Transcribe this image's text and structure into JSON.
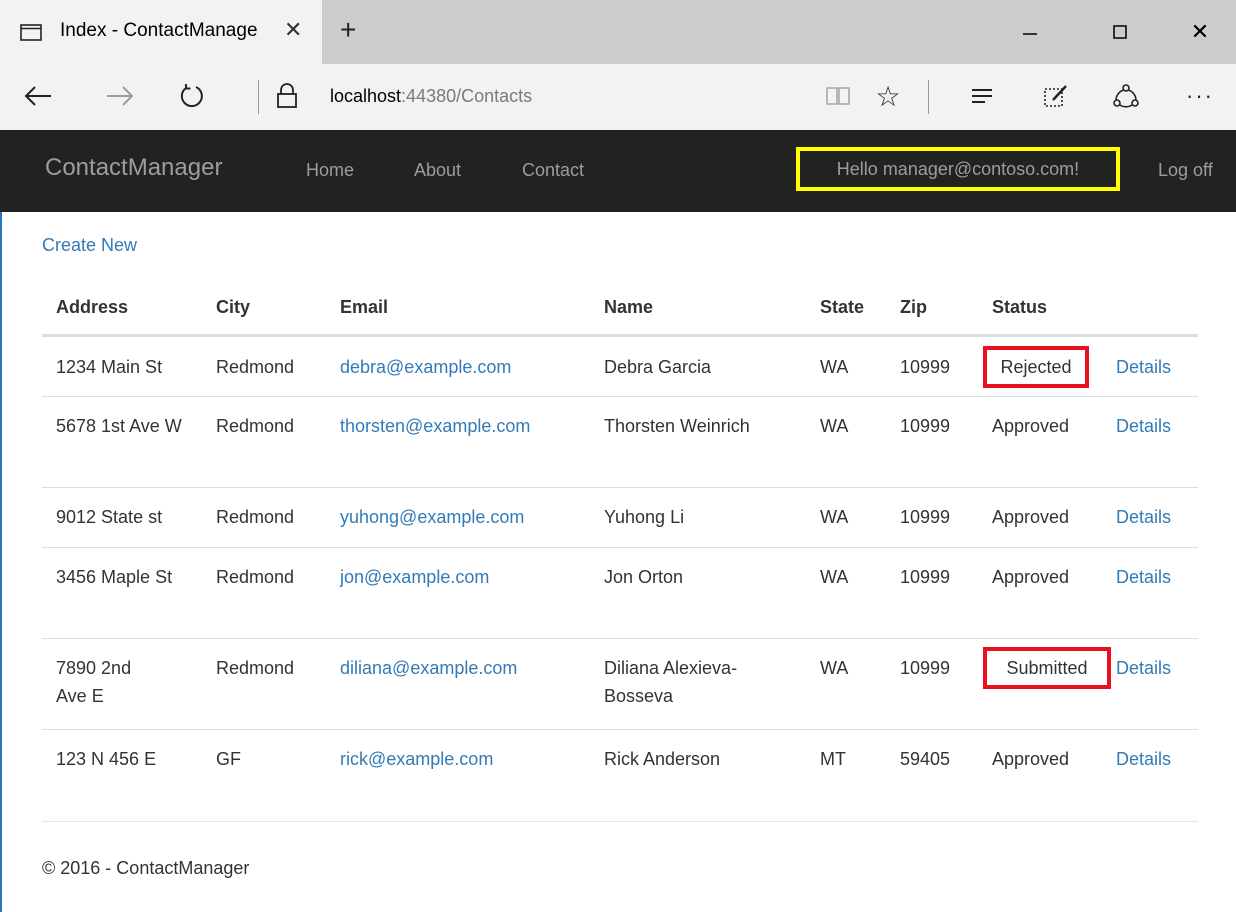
{
  "browser": {
    "tab_title": "Index - ContactManage",
    "url_host": "localhost",
    "url_rest": ":44380/Contacts"
  },
  "navbar": {
    "brand": "ContactManager",
    "links": [
      "Home",
      "About",
      "Contact"
    ],
    "hello": "Hello manager@contoso.com!",
    "logoff": "Log off",
    "highlight_color": "#ffff00"
  },
  "main": {
    "create_new": "Create New",
    "columns": [
      "Address",
      "City",
      "Email",
      "Name",
      "State",
      "Zip",
      "Status"
    ],
    "rows": [
      {
        "address": "1234 Main St",
        "city": "Redmond",
        "email": "debra@example.com",
        "name": "Debra Garcia",
        "state": "WA",
        "zip": "10999",
        "status": "Rejected",
        "details": "Details"
      },
      {
        "address": "5678 1st Ave W",
        "city": "Redmond",
        "email": "thorsten@example.com",
        "name": "Thorsten Weinrich",
        "state": "WA",
        "zip": "10999",
        "status": "Approved",
        "details": "Details"
      },
      {
        "address": "9012 State st",
        "city": "Redmond",
        "email": "yuhong@example.com",
        "name": "Yuhong Li",
        "state": "WA",
        "zip": "10999",
        "status": "Approved",
        "details": "Details"
      },
      {
        "address": "3456 Maple St",
        "city": "Redmond",
        "email": "jon@example.com",
        "name": "Jon Orton",
        "state": "WA",
        "zip": "10999",
        "status": "Approved",
        "details": "Details"
      },
      {
        "address": "7890 2nd Ave E",
        "city": "Redmond",
        "email": "diliana@example.com",
        "name": "Diliana Alexieva-Bosseva",
        "state": "WA",
        "zip": "10999",
        "status": "Submitted",
        "details": "Details"
      },
      {
        "address": "123 N 456 E",
        "city": "GF",
        "email": "rick@example.com",
        "name": "Rick Anderson",
        "state": "MT",
        "zip": "59405",
        "status": "Approved",
        "details": "Details"
      }
    ],
    "status_highlight_color": "#e8101e"
  },
  "footer": {
    "text": "© 2016 - ContactManager"
  }
}
